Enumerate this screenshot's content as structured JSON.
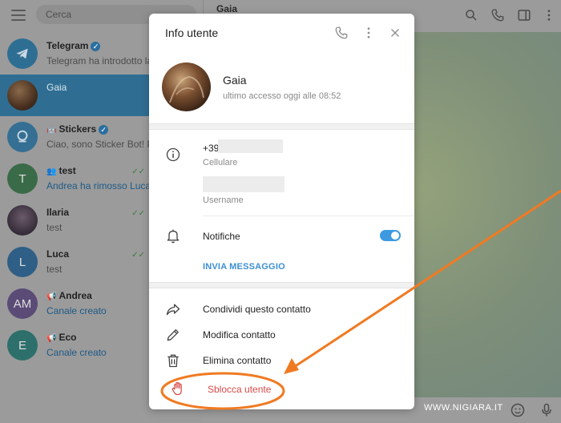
{
  "sidebar": {
    "search_placeholder": "Cerca",
    "chats": [
      {
        "name": "Telegram",
        "preview": "Telegram ha introdotto la",
        "avatar_letter": "",
        "avatar_color": "#2f6e93"
      },
      {
        "name": "Gaia",
        "preview": "",
        "avatar_letter": "",
        "avatar_color": "#5a3a24"
      },
      {
        "name": "Stickers",
        "preview": "Ciao, sono Sticker Bot! Po",
        "avatar_letter": "",
        "avatar_color": "#356f93"
      },
      {
        "name": "test",
        "preview": "Andrea ha rimosso Luca",
        "avatar_letter": "T",
        "avatar_color": "#3a6b48"
      },
      {
        "name": "Ilaria",
        "preview": "test",
        "avatar_letter": "",
        "avatar_color": "#3d3240"
      },
      {
        "name": "Luca",
        "preview": "test",
        "avatar_letter": "L",
        "avatar_color": "#2f5f86"
      },
      {
        "name": "Andrea",
        "preview": "Canale creato",
        "avatar_letter": "AM",
        "avatar_color": "#5a4b77"
      },
      {
        "name": "Eco",
        "preview": "Canale creato",
        "avatar_letter": "E",
        "avatar_color": "#2d6f6b"
      }
    ]
  },
  "chat_header": {
    "title": "Gaia"
  },
  "dialog": {
    "title": "Info utente",
    "profile": {
      "name": "Gaia",
      "status": "ultimo accesso oggi alle 08:52"
    },
    "phone": {
      "value": "+39",
      "label": "Cellulare"
    },
    "username": {
      "label": "Username"
    },
    "notifications": {
      "label": "Notifiche",
      "enabled": true
    },
    "send_message": "INVIA MESSAGGIO",
    "actions": {
      "share": "Condividi questo contatto",
      "edit": "Modifica contatto",
      "delete": "Elimina contatto",
      "unblock": "Sblocca utente"
    }
  },
  "watermark": "WWW.NIGIARA.IT",
  "colors": {
    "accent": "#3d9ae0",
    "danger": "#d84a4a",
    "annotation": "#f07a22"
  },
  "icons": [
    "menu-icon",
    "verified-icon",
    "phone-icon",
    "more-icon",
    "close-icon",
    "info-icon",
    "bell-icon",
    "share-icon",
    "pencil-icon",
    "trash-icon",
    "hand-icon",
    "search-icon",
    "sidebar-icon",
    "emoji-icon",
    "mic-icon"
  ]
}
